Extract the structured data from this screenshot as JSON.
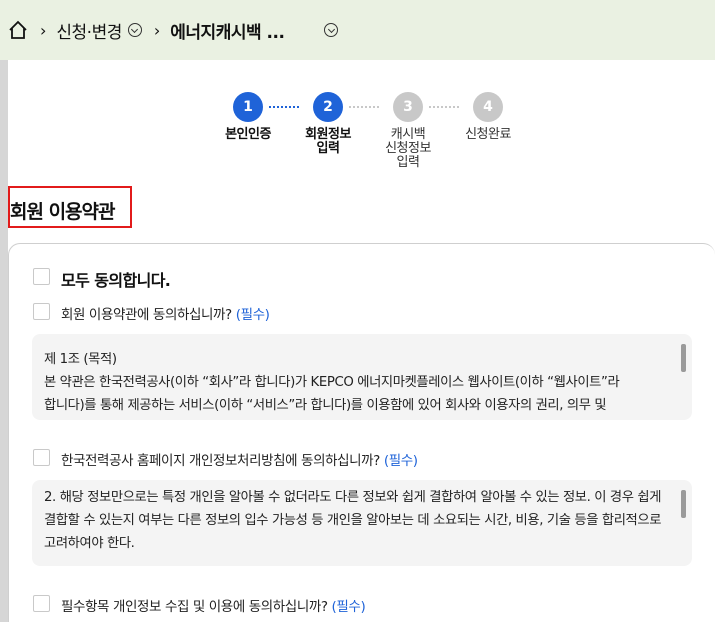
{
  "breadcrumb": {
    "item1": "신청·변경",
    "current": "에너지캐시백 ..."
  },
  "steps": [
    {
      "num": "1",
      "label": "본인인증",
      "active": true
    },
    {
      "num": "2",
      "label": "회원정보\n입력",
      "active": true
    },
    {
      "num": "3",
      "label": "캐시백\n신청정보\n입력",
      "active": false
    },
    {
      "num": "4",
      "label": "신청완료",
      "active": false
    }
  ],
  "section_title": "회원 이용약관",
  "terms": {
    "agree_all": "모두 동의합니다.",
    "items": [
      {
        "label": "회원 이용약관에 동의하십니까?",
        "required": "(필수)"
      },
      {
        "label": "한국전력공사 홈페이지 개인정보처리방침에 동의하십니까?",
        "required": "(필수)"
      },
      {
        "label": "필수항목 개인정보 수집 및 이용에 동의하십니까?",
        "required": "(필수)"
      }
    ],
    "box1": {
      "heading": "제 1조 (목적)",
      "line1": "본 약관은 한국전력공사(이하 “회사”라 합니다)가 KEPCO 에너지마켓플레이스 웹사이트(이하 “웹사이트”라",
      "line2": "합니다)를 통해 제공하는 서비스(이하 “서비스”라 합니다)를 이용함에 있어 회사와 이용자의 권리, 의무 및"
    },
    "box2": {
      "line1": "2. 해당 정보만으로는 특정 개인을 알아볼 수 없더라도 다른 정보와 쉽게 결합하여 알아볼 수 있는 정보. 이 경우 쉽게",
      "line2": "결합할 수 있는지 여부는 다른 정보의 입수 가능성 등 개인을 알아보는 데 소요되는 시간, 비용, 기술 등을 합리적으로",
      "line3": "고려하여야 한다."
    }
  }
}
